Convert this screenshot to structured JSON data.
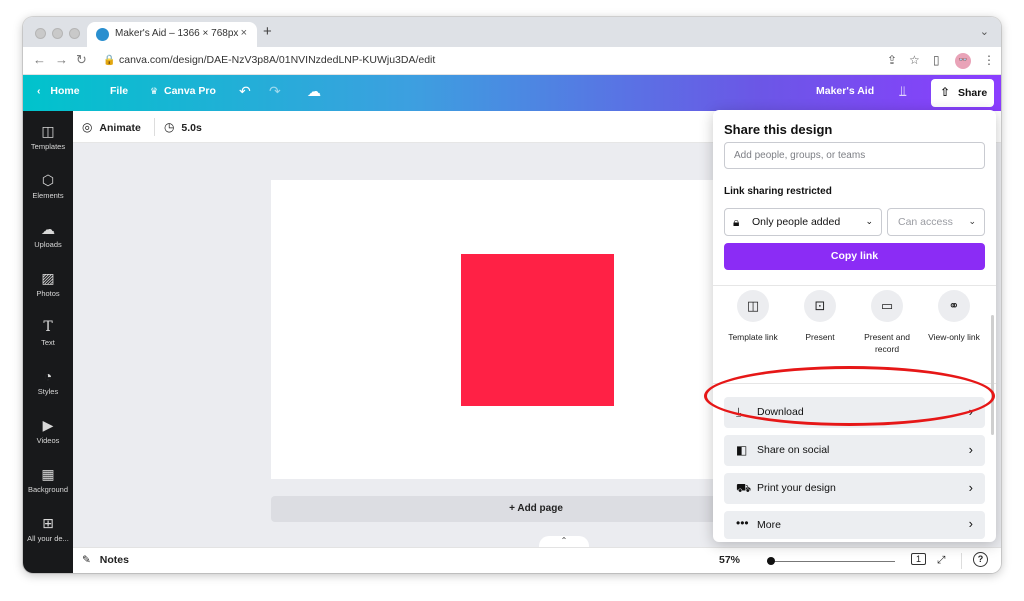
{
  "browser": {
    "tab_title": "Maker's Aid – 1366 × 768px",
    "tab_close": "×",
    "new_tab": "+",
    "url": "canva.com/design/DAE-NzV3p8A/01NVINzdedLNP-KUWju3DA/edit",
    "avatar_text": "👓"
  },
  "canva_header": {
    "home": "Home",
    "file": "File",
    "canva_pro": "Canva Pro",
    "team_name": "Maker's Aid",
    "share": "Share"
  },
  "sidebar": {
    "items": [
      {
        "label": "Templates",
        "icon": "templates-icon"
      },
      {
        "label": "Elements",
        "icon": "elements-icon"
      },
      {
        "label": "Uploads",
        "icon": "uploads-icon"
      },
      {
        "label": "Photos",
        "icon": "photos-icon"
      },
      {
        "label": "Text",
        "icon": "text-icon"
      },
      {
        "label": "Styles",
        "icon": "styles-icon"
      },
      {
        "label": "Videos",
        "icon": "videos-icon"
      },
      {
        "label": "Background",
        "icon": "background-icon"
      },
      {
        "label": "All your de...",
        "icon": "all-designs-icon"
      }
    ]
  },
  "subtoolbar": {
    "animate": "Animate",
    "duration": "5.0s"
  },
  "canvas": {
    "add_page": "+ Add page",
    "shape_color": "#ff2145"
  },
  "footer": {
    "notes": "Notes",
    "zoom": "57%",
    "page_count": "1"
  },
  "share_panel": {
    "title": "Share this design",
    "input_placeholder": "Add people, groups, or teams",
    "link_sharing": "Link sharing restricted",
    "access_scope": "Only people added",
    "access_level": "Can access",
    "copy_link": "Copy link",
    "options": [
      {
        "label": "Template link",
        "icon": "template-link-icon"
      },
      {
        "label": "Present",
        "icon": "present-icon"
      },
      {
        "label": "Present and record",
        "icon": "present-record-icon"
      },
      {
        "label": "View-only link",
        "icon": "view-only-link-icon"
      }
    ],
    "rows": [
      {
        "label": "Download",
        "icon": "download-icon"
      },
      {
        "label": "Share on social",
        "icon": "share-social-icon"
      },
      {
        "label": "Print your design",
        "icon": "print-truck-icon"
      },
      {
        "label": "More",
        "icon": "more-dots-icon"
      }
    ]
  },
  "colors": {
    "accent_purple": "#8b2cf5",
    "annotation_red": "#e61717"
  }
}
